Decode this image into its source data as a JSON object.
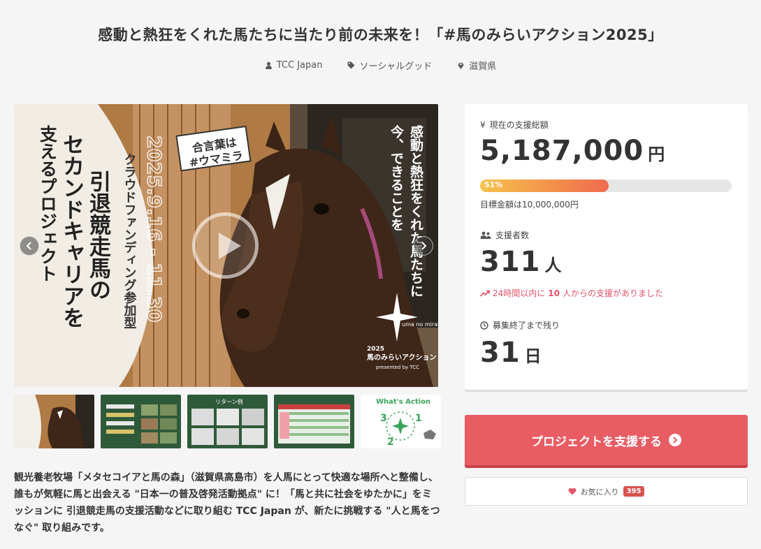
{
  "page": {
    "title": "感動と熱狂をくれた馬たちに当たり前の未来を！「#馬のみらいアクション2025」"
  },
  "meta": {
    "owner": "TCC Japan",
    "category": "ソーシャルグッド",
    "location": "滋賀県"
  },
  "hero": {
    "vertical_main": "引退競走馬の",
    "vertical_main2": "セカンドキャリアを",
    "vertical_main3": "支えるプロジェクト",
    "vertical_sub": "クラウドファンディング参加型",
    "dates": "2025.9.16 - 11.30",
    "tag_line1": "合言葉は",
    "tag_line2": "#ウマミラ",
    "right_text1": "感動と熱狂をくれた馬たちに",
    "right_text2": "今、できることを",
    "logo_small": "uma no mirai action",
    "logo_year": "2025",
    "logo_name": "馬のみらいアクション",
    "logo_by": "presented by TCC"
  },
  "thumbs": [
    {
      "name": "thumb-1"
    },
    {
      "name": "thumb-2"
    },
    {
      "name": "thumb-3",
      "caption": "リターン例"
    },
    {
      "name": "thumb-4"
    },
    {
      "name": "thumb-5",
      "caption": "What's Action"
    }
  ],
  "description": "観光養老牧場「メタセコイアと馬の森」（滋賀県高島市）を人馬にとって快適な場所へと整備し、誰もが気軽に馬と出会える \"日本一の普及啓発活動拠点\" に！「馬と共に社会をゆたかに」をミッションに 引退競走馬の支援活動などに取り組む TCC Japan が、新たに挑戦する \"人と馬をつなぐ\" 取り組みです。",
  "stats": {
    "total_label": "現在の支援総額",
    "total_value": "5,187,000",
    "total_unit": "円",
    "progress_percent": 51,
    "progress_label": "51%",
    "goal_text": "目標金額は10,000,000円",
    "supporters_label": "支援者数",
    "supporters_value": "311",
    "supporters_unit": "人",
    "trend_pre": "24時間以内に",
    "trend_num": "10",
    "trend_post": "人からの支援がありました",
    "remaining_label": "募集終了まで残り",
    "remaining_value": "31",
    "remaining_unit": "日"
  },
  "actions": {
    "support_button": "プロジェクトを支援する",
    "favorite_label": "お気に入り",
    "favorite_count": "395"
  },
  "colors": {
    "accent": "#e85c64",
    "trend": "#e4546a",
    "progress_start": "#f6c24a",
    "progress_end": "#f06a4e"
  }
}
